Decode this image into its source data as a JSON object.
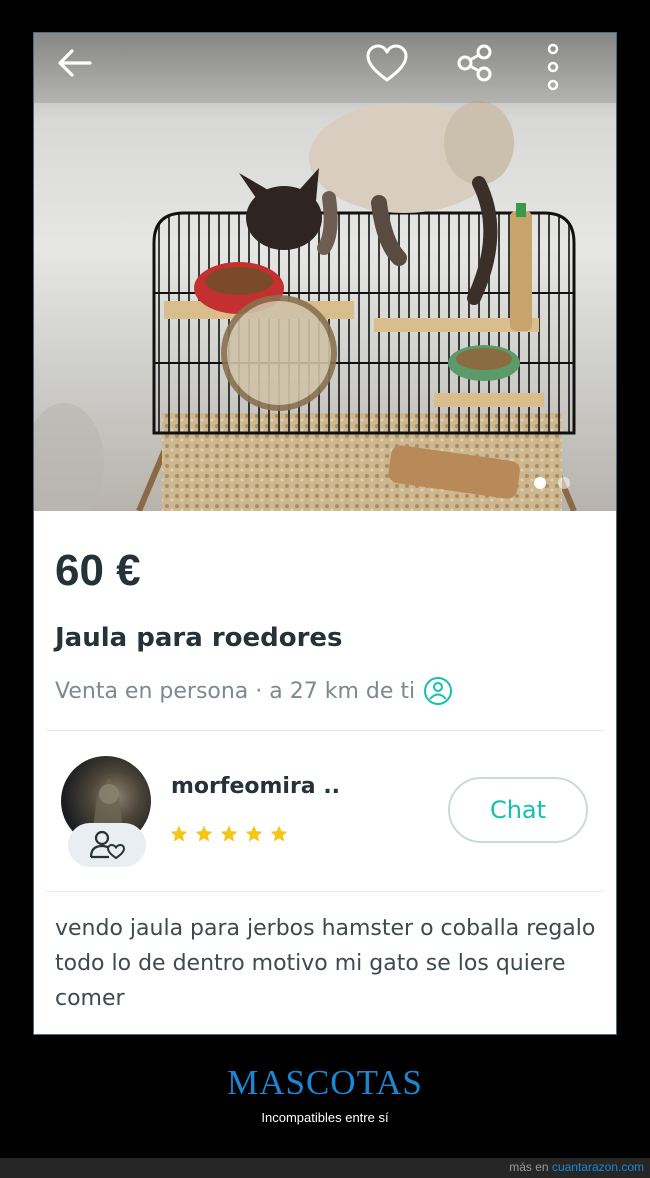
{
  "listing": {
    "price": "60 €",
    "title": "Jaula para roedores",
    "delivery": "Venta en persona · a 27 km de ti",
    "description": "vendo jaula para jerbos hamster o coballa regalo todo lo de dentro motivo mi gato se los quiere comer",
    "photo_count": 2,
    "photo_index": 1
  },
  "seller": {
    "name": "morfeomira ..",
    "rating": 5,
    "chat_label": "Chat"
  },
  "caption": {
    "title": "MASCOTAS",
    "subtitle": "Incompatibles entre sí",
    "footer_prefix": "más en",
    "footer_link": "cuantarazon.com"
  },
  "icons": {
    "back": "arrow-left-icon",
    "favorite": "heart-icon",
    "share": "share-icon",
    "more": "more-vertical-icon",
    "location": "person-location-icon",
    "follow": "follow-user-icon",
    "star": "star-icon"
  },
  "colors": {
    "accent": "#13c1ac",
    "star": "#f5c518",
    "caption": "#1a86d4",
    "text_dark": "#253238",
    "text_muted": "#7b8a91"
  }
}
